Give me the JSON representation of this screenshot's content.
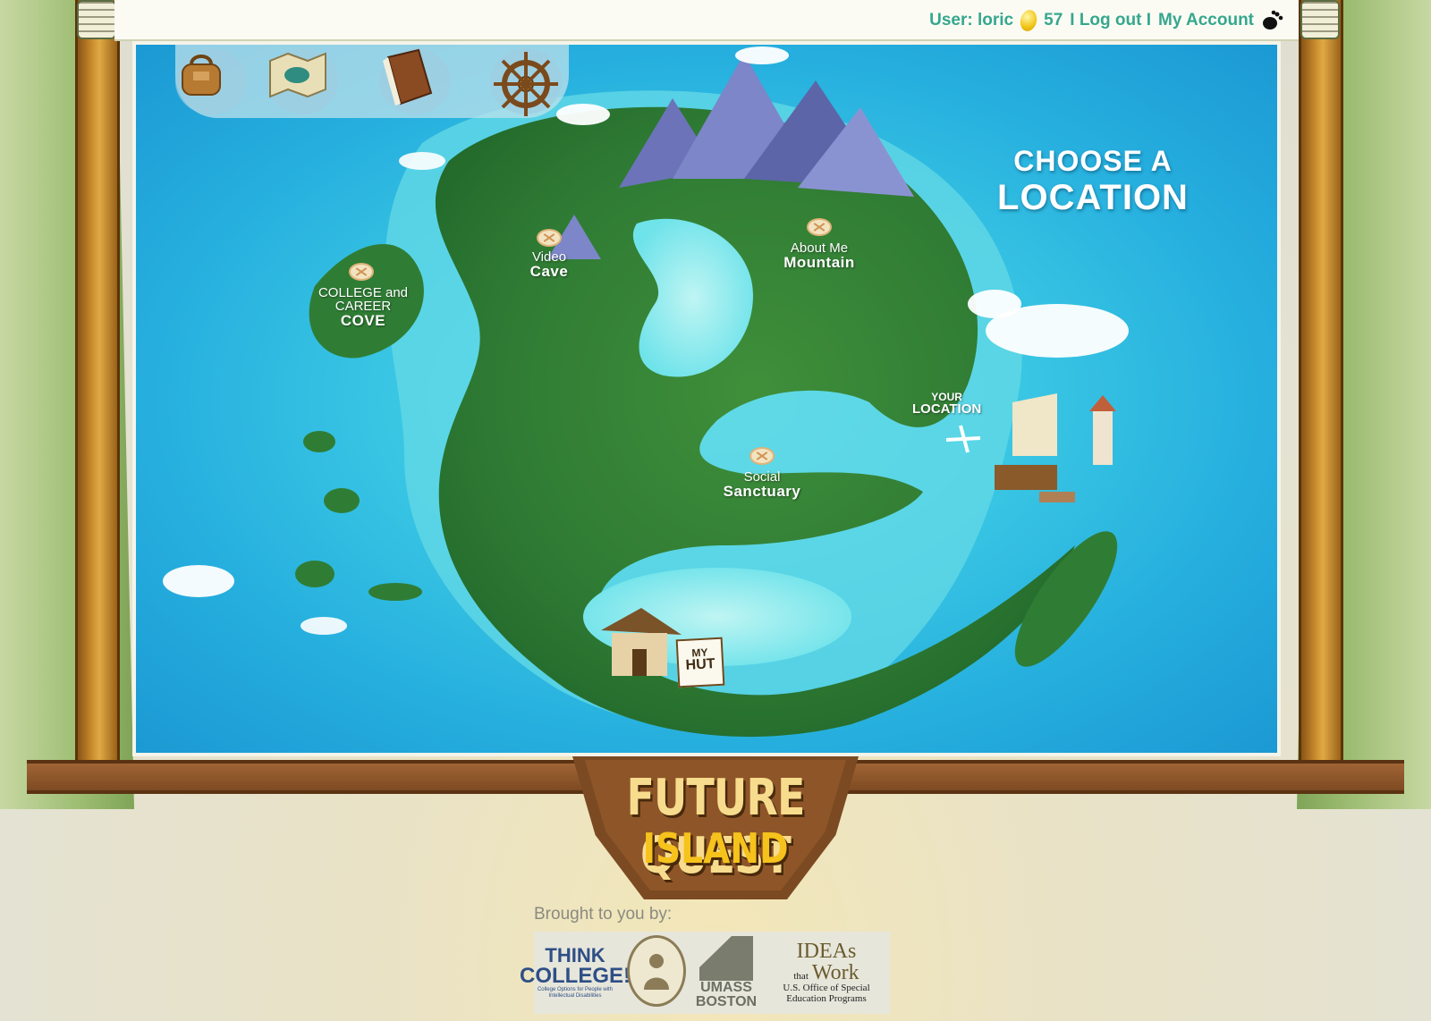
{
  "topbar": {
    "user_label": "User: loric",
    "coins": "57",
    "logout_label": "I Log out I",
    "account_label": "My Account"
  },
  "toolbar": {
    "items": [
      {
        "name": "backpack-icon"
      },
      {
        "name": "map-icon"
      },
      {
        "name": "book-icon"
      },
      {
        "name": "ship-wheel-icon"
      }
    ]
  },
  "map": {
    "heading_line1": "CHOOSE A",
    "heading_line2": "LOCATION",
    "locations": [
      {
        "small": "COLLEGE and CAREER",
        "big": "COVE"
      },
      {
        "small": "Video",
        "big": "Cave"
      },
      {
        "small": "About Me",
        "big": "Mountain"
      },
      {
        "small": "Social",
        "big": "Sanctuary"
      }
    ],
    "your_location_line1": "YOUR",
    "your_location_line2": "LOCATION",
    "hut_line1": "MY",
    "hut_line2": "HUT"
  },
  "brand": {
    "title_line1": "FUTURE QUEST",
    "title_line2": "ISLAND"
  },
  "footer": {
    "brought_by": "Brought to you by:",
    "logos": {
      "think_line1": "THINK",
      "think_line2": "COLLEGE!",
      "think_tagline": "College Options for People with Intellectual Disabilities",
      "umass_line1": "UMASS",
      "umass_line2": "BOSTON",
      "ideas_line1": "IDEAs",
      "ideas_that": "that",
      "ideas_work": "Work",
      "ideas_line2": "U.S. Office of Special Education Programs"
    }
  },
  "colors": {
    "accent_teal": "#36a78d",
    "sea": "#25aede",
    "frame_wood": "#8e5628",
    "title_yellow": "#f6c21c"
  }
}
